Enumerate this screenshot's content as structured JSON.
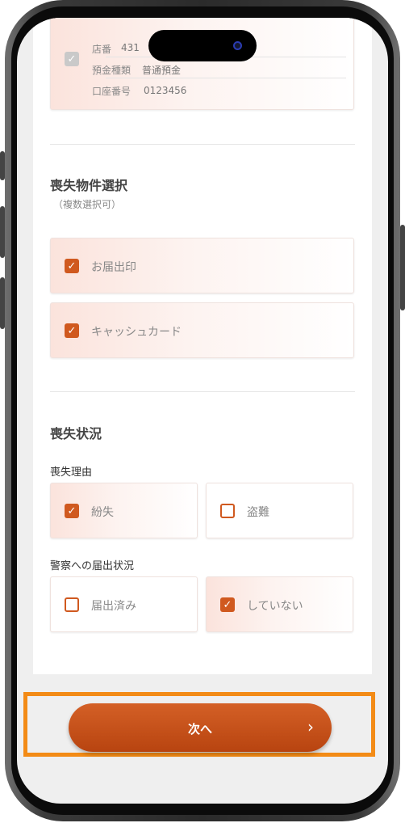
{
  "bank": {
    "checked": true,
    "rows": [
      {
        "key": "店番",
        "value": "431"
      },
      {
        "key": "預金種類",
        "value": "普通預金"
      },
      {
        "key": "口座番号",
        "value": "0123456"
      }
    ]
  },
  "lost_items": {
    "title": "喪失物件選択",
    "note": "（複数選択可）",
    "options": [
      {
        "label": "お届出印",
        "checked": true
      },
      {
        "label": "キャッシュカード",
        "checked": true
      }
    ]
  },
  "loss_status": {
    "title": "喪失状況",
    "reason": {
      "label": "喪失理由",
      "options": [
        {
          "label": "紛失",
          "checked": true
        },
        {
          "label": "盗難",
          "checked": false
        }
      ]
    },
    "police": {
      "label": "警察への届出状況",
      "options": [
        {
          "label": "届出済み",
          "checked": false
        },
        {
          "label": "していない",
          "checked": true
        }
      ]
    }
  },
  "next_button": {
    "label": "次へ"
  },
  "colors": {
    "accent": "#d0591f",
    "highlight": "#f38b16"
  }
}
